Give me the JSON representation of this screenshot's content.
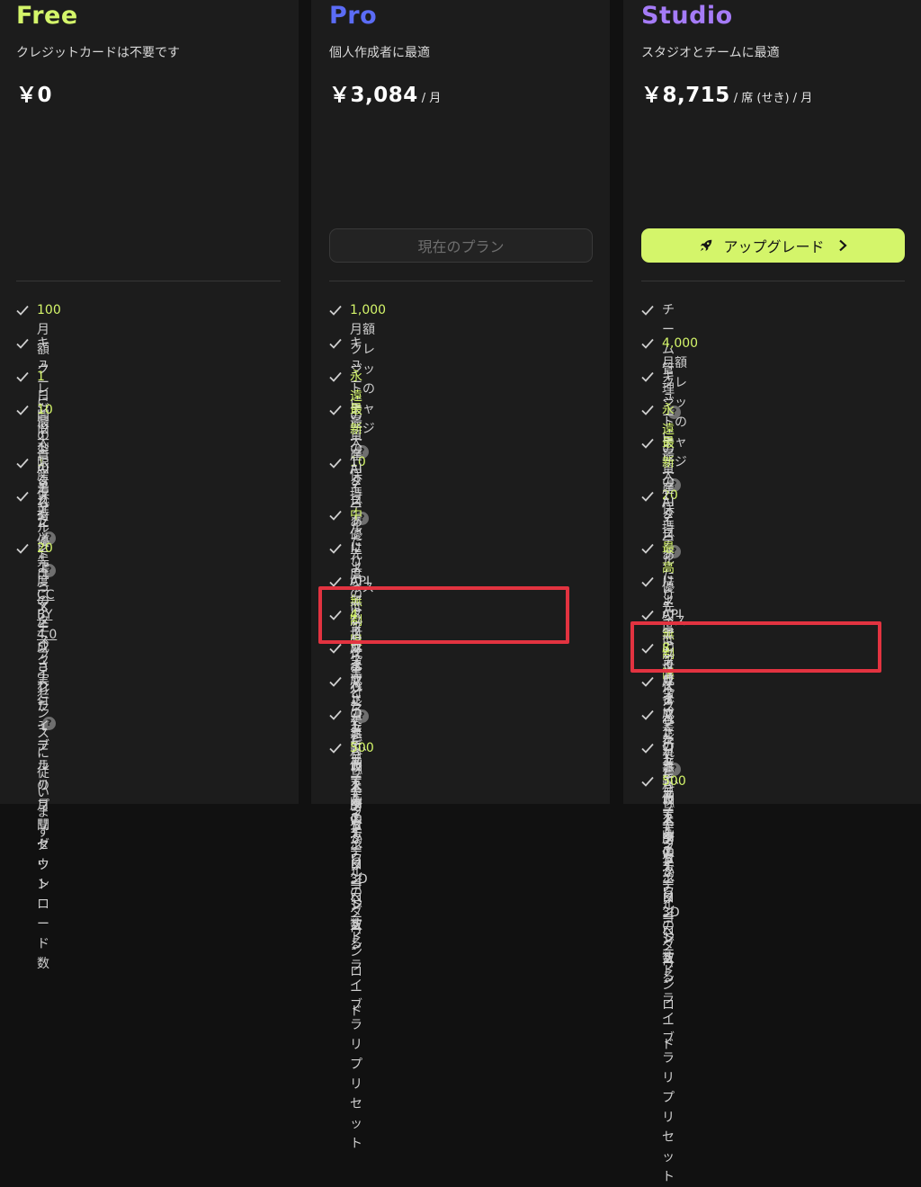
{
  "colors": {
    "accent": "#d4f56a",
    "free": "#d4f56a",
    "pro": "#5b6cf6",
    "studio": "#a57bf7",
    "highlight_box": "#e23340"
  },
  "free": {
    "name": "Free",
    "subtitle": "クレジットカードは不要です",
    "price": "￥0",
    "features": [
      {
        "hl": "100",
        "t1": " 月額クレジットのチャージ",
        "help": true
      },
      {
        "t0": "キューに最大 ",
        "hl": "1",
        "t1": " タスク"
      },
      {
        "hl": "1",
        "t1": "日間の資産保持",
        "help": true
      },
      {
        "hl": "10",
        "t1": " 旧型AIモデルによって生成されたモデ",
        "line2": "ルの月間ダウンロード数"
      },
      {
        "t0": "限られた優先度のタスク実行",
        "help": true
      },
      {
        "t0": "アセットは ",
        "u": "CC BY 4.0",
        "t1": " ライセンスに従",
        "line2": "います"
      },
      {
        "hl": "20",
        "t1": " アニメーションライブラリプリセッ",
        "line2": "ト"
      }
    ]
  },
  "pro": {
    "name": "Pro",
    "subtitle": "個人作成者に最適",
    "price": "￥3,084",
    "price_unit": "/ 月",
    "button_label": "現在のプラン",
    "features": [
      {
        "hl": "1,000",
        "t1": " 月額クレジットのチャージ",
        "help": true
      },
      {
        "t0": "キューに最大 ",
        "hl": "10",
        "t1": " タスク"
      },
      {
        "hl": "永遠",
        "t1": "の資産保持",
        "help": true
      },
      {
        "hl": "最新",
        "t1": "のAIモデルによって生成されたモデ",
        "line2": "ルをダウンロードする"
      },
      {
        "t0": "1ヶ月あたりの",
        "hl": "無制限",
        "t1": "生成されたモデル",
        "line2": "のダウンロード"
      },
      {
        "hl": "中",
        "t1": "優先度のタスク実行",
        "help": true
      },
      {
        "t0": "リソースはプライベートで、個人所有"
      },
      {
        "t0": "API アクセス"
      },
      {
        "hl": "4",
        "t1": " 世代ごとの無料リトライ"
      },
      {
        "t0": "リメッシュとカスタムポリゴン数"
      },
      {
        "t0": "マルチビュー画像から3Dへ"
      },
      {
        "t0": "コミュニティモデルのダウンロード"
      },
      {
        "hl": "500",
        "t1": " 以上のアニメーションライブラリプ",
        "line2": "リセット"
      }
    ]
  },
  "studio": {
    "name": "Studio",
    "subtitle": "スタジオとチームに最適",
    "price": "￥8,715",
    "price_unit": "/ 席 (せき) / 月",
    "button_label": "アップグレード",
    "features": [
      {
        "t0": "チーム管理",
        "help": true
      },
      {
        "hl": "4,000",
        "t1": " 月額クレジットのチャージ",
        "help": true
      },
      {
        "t0": "キューに最大 ",
        "hl": "20",
        "t1": " タスク"
      },
      {
        "hl": "永遠",
        "t1": "の資産保持",
        "help": true
      },
      {
        "hl": "最新",
        "t1": "のAIモデルによって生成されたモデ",
        "line2": "ルをダウンロードする"
      },
      {
        "t0": "1ヶ月あたりの",
        "hl": "無制限",
        "t1": "生成されたモデル",
        "line2": "のダウンロード"
      },
      {
        "hl": "最高",
        "t1": "優先度のタスク実行",
        "help": true
      },
      {
        "t0": "リソースはプライベートで、個人所有"
      },
      {
        "t0": "API アクセス"
      },
      {
        "hl": "8",
        "t1": " 世代ごとの無料リトライ"
      },
      {
        "t0": "リメッシュとカスタムポリゴン数"
      },
      {
        "t0": "マルチビュー画像から3Dへ"
      },
      {
        "t0": "コミュニティモデルのダウンロード"
      },
      {
        "hl": "500",
        "t1": " 以上のアニメーションライブラリプ",
        "line2": "リセット"
      }
    ]
  }
}
